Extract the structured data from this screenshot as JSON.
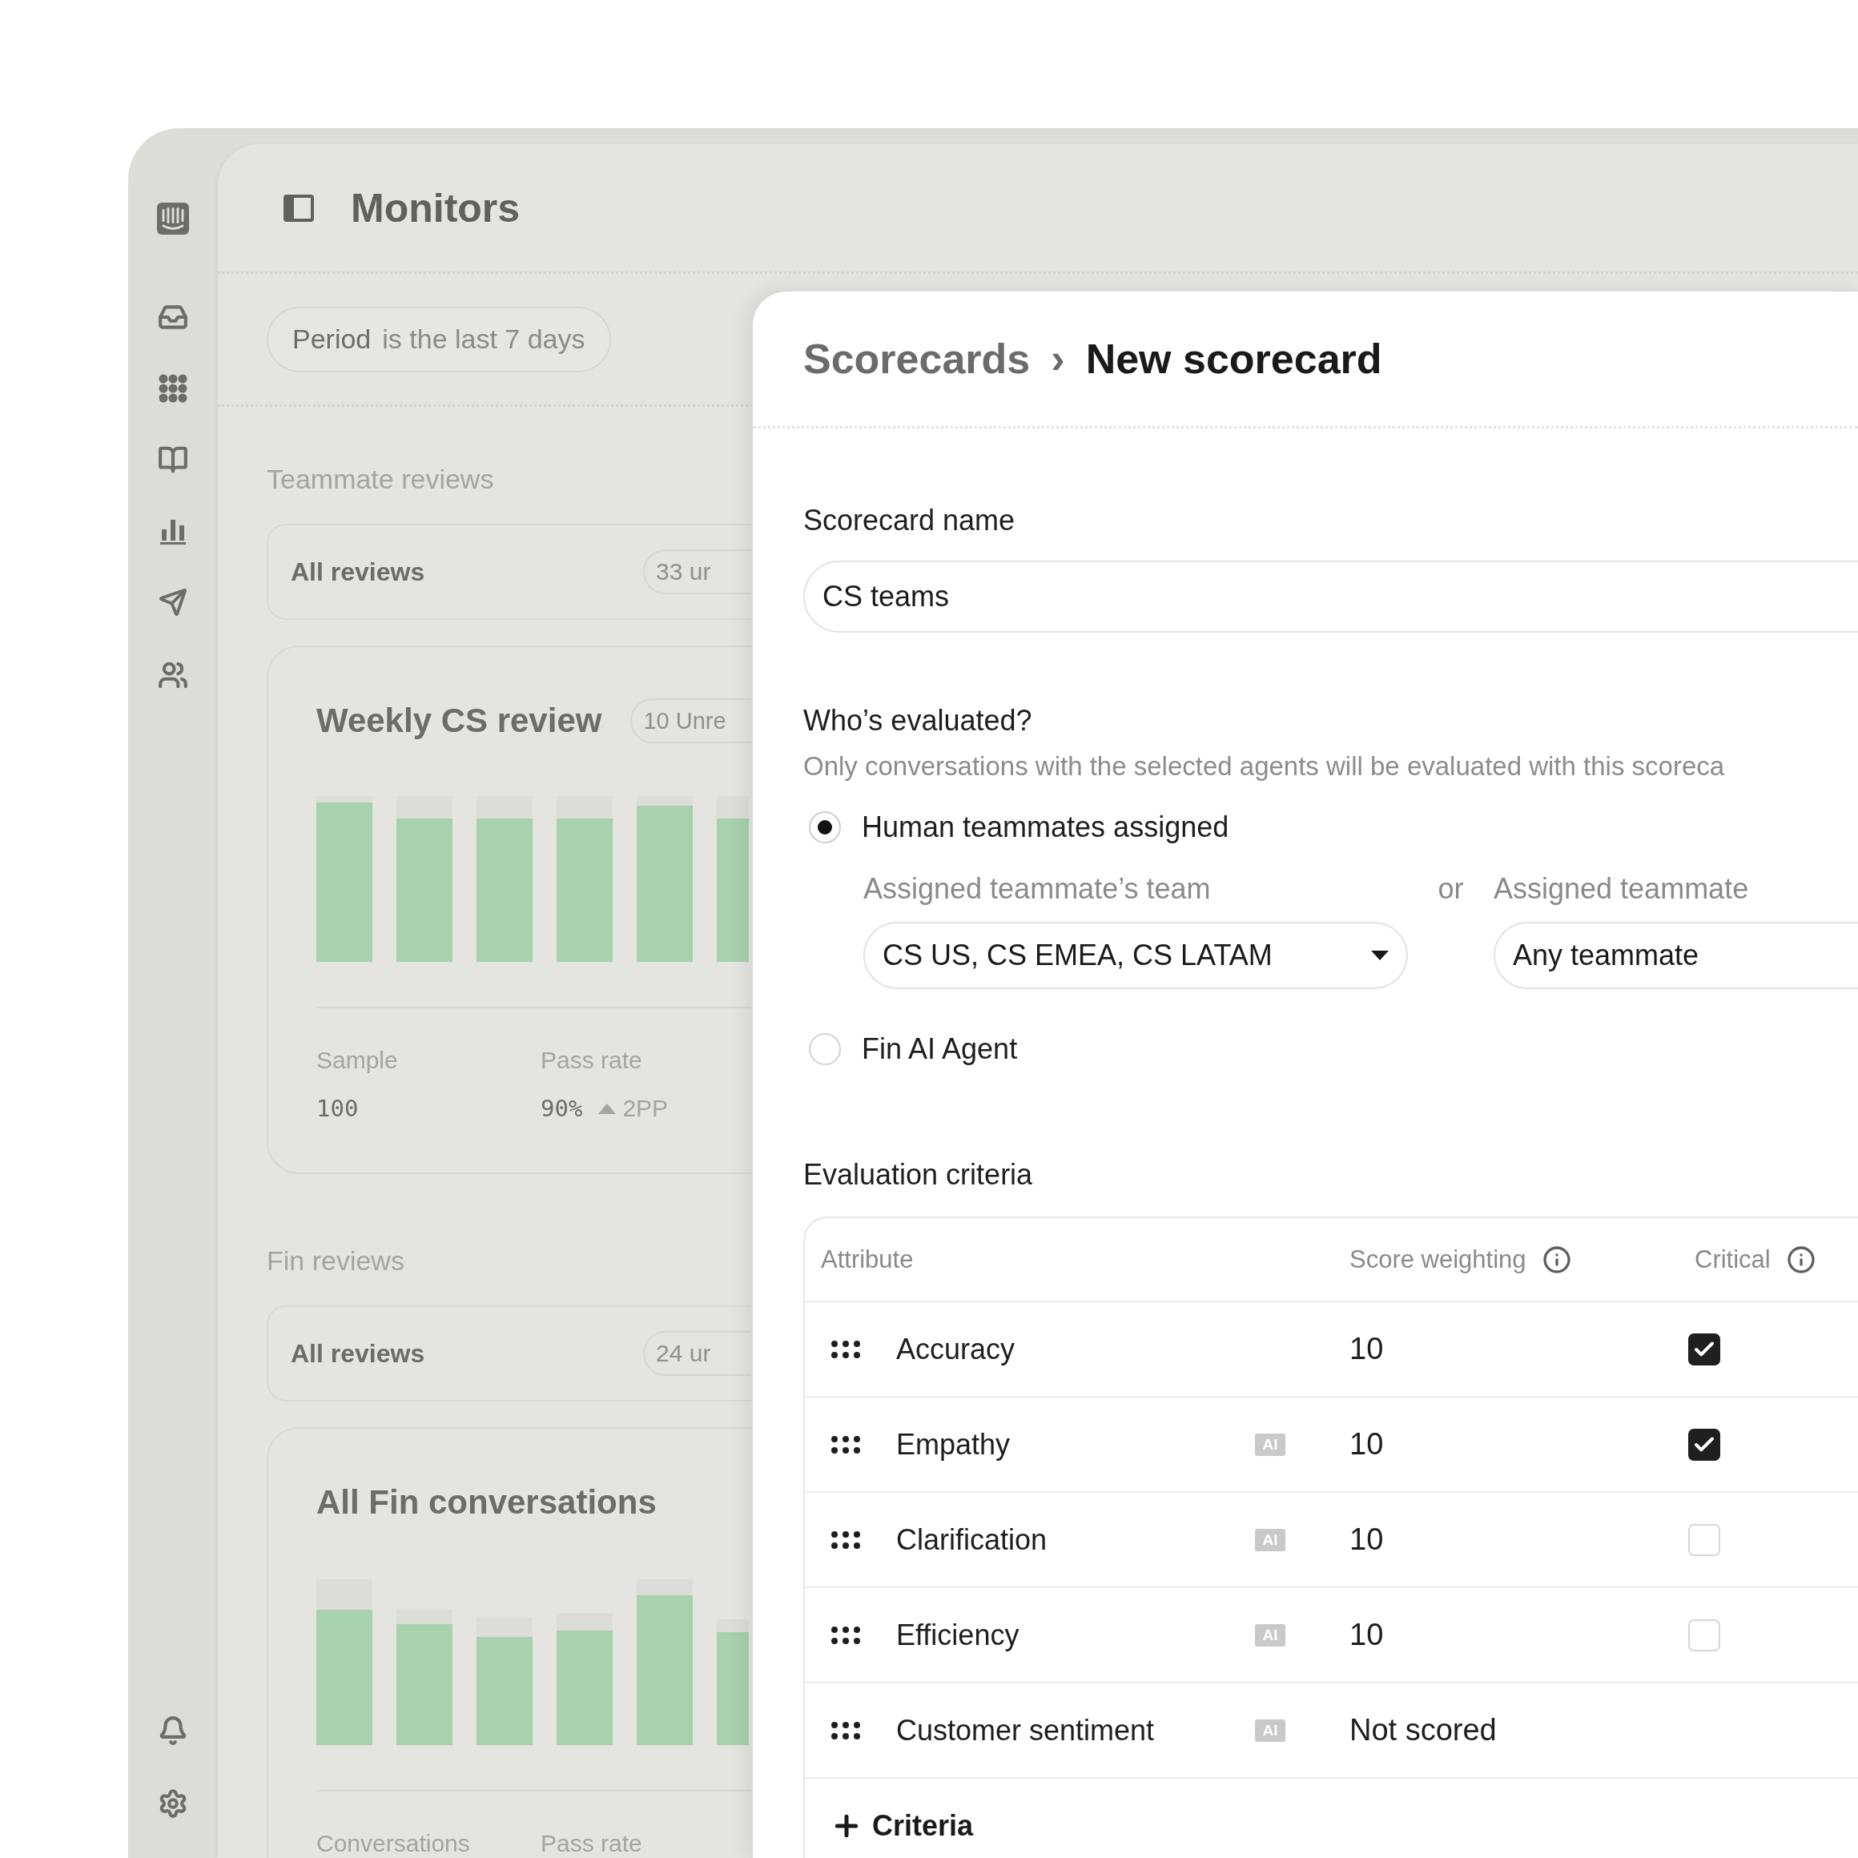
{
  "monitors": {
    "title": "Monitors",
    "filter": {
      "label": "Period",
      "value": "is the last 7 days"
    },
    "sections": [
      {
        "heading": "Teammate reviews",
        "summary": {
          "label": "All reviews",
          "badge": "33 ur"
        },
        "card": {
          "title": "Weekly CS review",
          "badge": "10 Unre",
          "stats": [
            {
              "label": "Sample",
              "value": "100"
            },
            {
              "label": "Pass rate",
              "value": "90%",
              "delta": "2PP"
            }
          ]
        }
      },
      {
        "heading": "Fin reviews",
        "summary": {
          "label": "All reviews",
          "badge": "24 ur"
        },
        "card": {
          "title": "All Fin conversations",
          "stats": [
            {
              "label": "Conversations"
            },
            {
              "label": "Pass rate"
            }
          ]
        }
      }
    ]
  },
  "scorecard": {
    "breadcrumb": {
      "parent": "Scorecards",
      "separator": "›",
      "current": "New scorecard"
    },
    "name": {
      "label": "Scorecard name",
      "value": "CS teams"
    },
    "evaluated": {
      "heading": "Who’s evaluated?",
      "description": "Only conversations with the selected agents will be evaluated with this scoreca",
      "options": [
        {
          "label": "Human teammates assigned",
          "selected": true,
          "team_label": "Assigned teammate’s team",
          "team_value": "CS US, CS EMEA, CS LATAM",
          "or": "or",
          "teammate_label": "Assigned teammate",
          "teammate_value": "Any teammate"
        },
        {
          "label": "Fin AI Agent",
          "selected": false
        }
      ]
    },
    "criteria": {
      "heading": "Evaluation criteria",
      "columns": [
        "Attribute",
        "Score weighting",
        "Critical"
      ],
      "rows": [
        {
          "name": "Accuracy",
          "score": "10",
          "critical": true
        },
        {
          "name": "Empathy",
          "tag": "AI",
          "score": "10",
          "critical": true
        },
        {
          "name": "Clarification",
          "tag": "AI",
          "score": "10",
          "critical": false
        },
        {
          "name": "Efficiency",
          "tag": "AI",
          "score": "10",
          "critical": false
        },
        {
          "name": "Customer sentiment",
          "tag": "AI",
          "score": "Not scored"
        }
      ],
      "add": "Criteria"
    }
  }
}
